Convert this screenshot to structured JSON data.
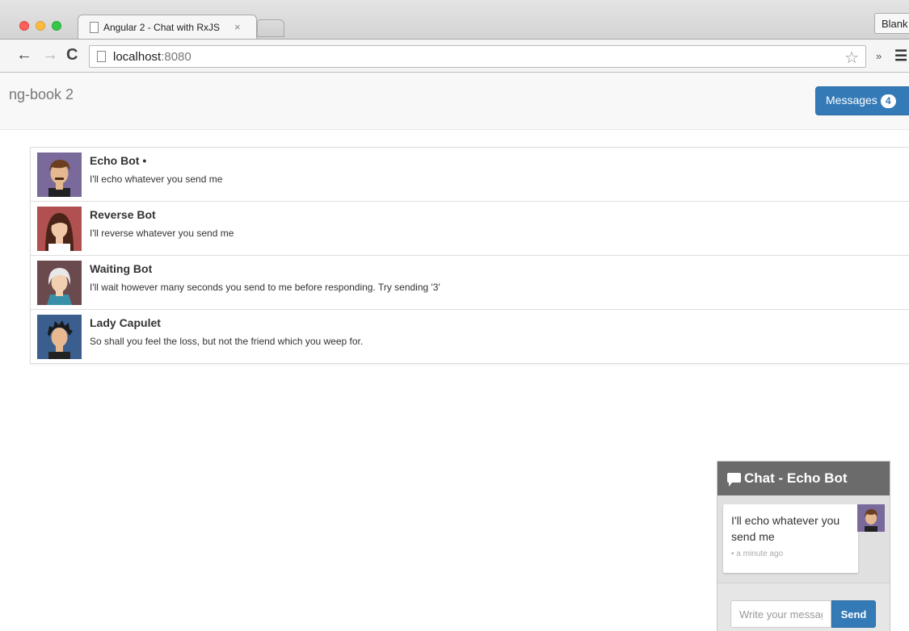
{
  "browser": {
    "tab_title": "Angular 2 - Chat with RxJS",
    "tab_close": "×",
    "blank_button": "Blank",
    "url_host": "localhost",
    "url_port": ":8080",
    "icons": {
      "back": "arrow-left-icon",
      "forward": "arrow-right-icon",
      "reload": "reload-icon",
      "star": "star-icon",
      "extensions": "chevron-double-icon",
      "menu": "hamburger-menu-icon"
    }
  },
  "navbar": {
    "brand": "ng-book 2",
    "messages_label": "Messages",
    "unread_count": "4",
    "button_color": "#337ab7"
  },
  "threads": [
    {
      "name": "Echo Bot •",
      "snippet": "I'll echo whatever you send me",
      "avatar_bg": "#7a6a9c"
    },
    {
      "name": "Reverse Bot",
      "snippet": "I'll reverse whatever you send me",
      "avatar_bg": "#b05050"
    },
    {
      "name": "Waiting Bot",
      "snippet": "I'll wait however many seconds you send to me before responding. Try sending '3'",
      "avatar_bg": "#6b4a4e"
    },
    {
      "name": "Lady Capulet",
      "snippet": "So shall you feel the loss, but not the friend which you weep for.",
      "avatar_bg": "#3a5f8f"
    }
  ],
  "chat": {
    "title": "Chat - Echo Bot",
    "messages": [
      {
        "text": "I'll echo whatever you send me",
        "time": "• a minute ago"
      }
    ],
    "input_placeholder": "Write your message here",
    "send_label": "Send"
  }
}
